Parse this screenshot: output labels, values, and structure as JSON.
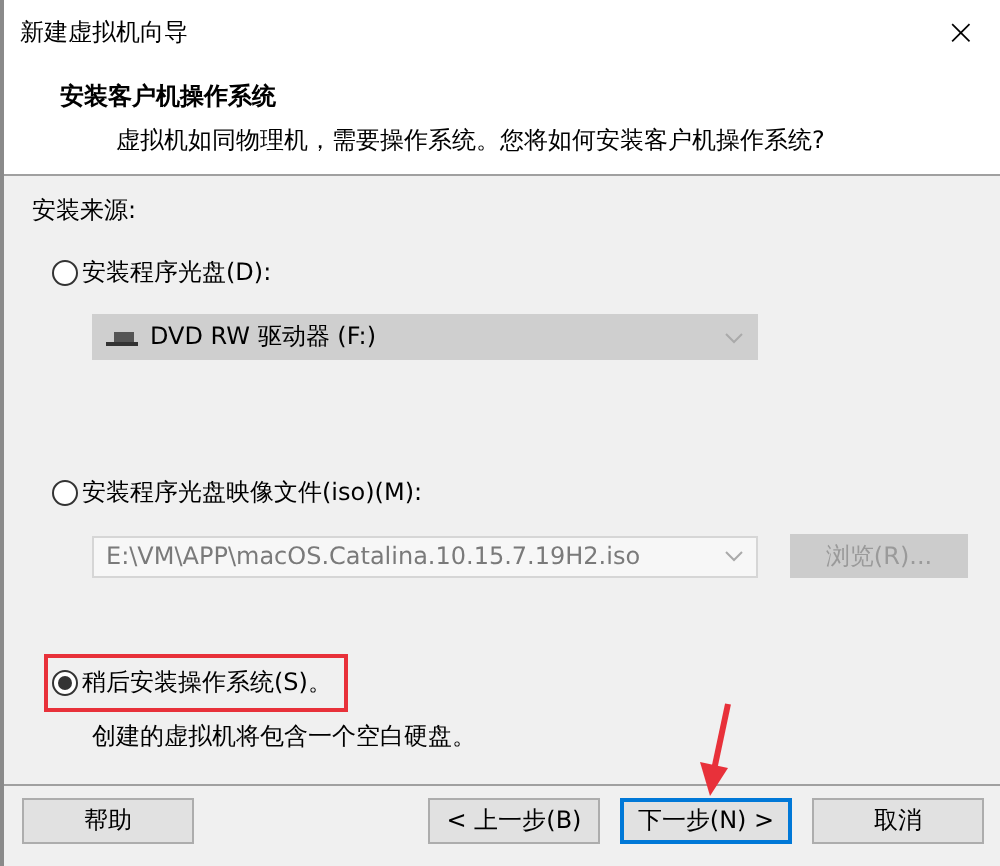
{
  "window": {
    "title": "新建虚拟机向导",
    "close": "×"
  },
  "header": {
    "title": "安装客户机操作系统",
    "subtitle": "虚拟机如同物理机，需要操作系统。您将如何安装客户机操作系统?"
  },
  "source_label": "安装来源:",
  "options": [
    {
      "kind": "drive",
      "label": "安装程序光盘(D):",
      "selected": false,
      "combo": {
        "value": "DVD RW 驱动器 (F:)",
        "disabled": true
      }
    },
    {
      "kind": "image",
      "label": "安装程序光盘映像文件(iso)(M):",
      "selected": false,
      "combo": {
        "value": "E:\\VM\\APP\\macOS.Catalina.10.15.7.19H2.iso",
        "disabled": true
      },
      "button": {
        "label": "浏览(R)...",
        "disabled": true
      }
    },
    {
      "kind": "later",
      "label": "稍后安装操作系统(S)。",
      "selected": true,
      "highlighted": true,
      "description": "创建的虚拟机将包含一个空白硬盘。"
    }
  ],
  "buttons": [
    {
      "label": "帮助",
      "default": false,
      "pointed": false
    },
    {
      "label": "< 上一步(B)",
      "default": false,
      "pointed": false
    },
    {
      "label": "下一步(N) >",
      "default": true,
      "pointed": true
    },
    {
      "label": "取消",
      "default": false,
      "pointed": false
    }
  ]
}
